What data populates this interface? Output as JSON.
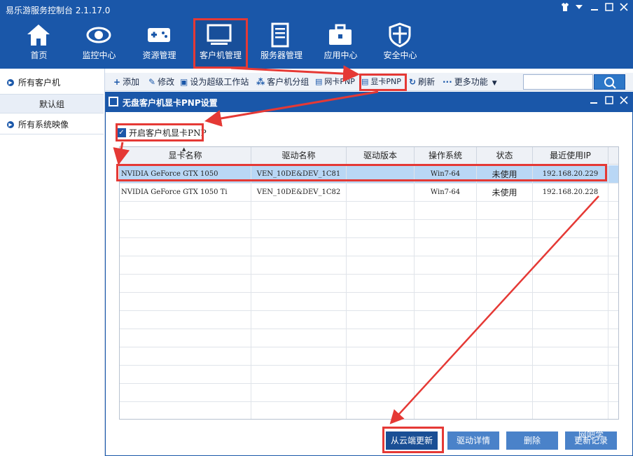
{
  "app": {
    "title": "易乐游服务控制台 2.1.17.0"
  },
  "window_controls": [
    "shirt-icon",
    "dropdown-icon",
    "minimize-icon",
    "maximize-icon",
    "close-icon"
  ],
  "nav": [
    {
      "label": "首页",
      "icon": "home-icon"
    },
    {
      "label": "监控中心",
      "icon": "eye-icon"
    },
    {
      "label": "资源管理",
      "icon": "gamepad-icon"
    },
    {
      "label": "客户机管理",
      "icon": "monitor-icon",
      "active": true
    },
    {
      "label": "服务器管理",
      "icon": "server-icon"
    },
    {
      "label": "应用中心",
      "icon": "toolbox-icon"
    },
    {
      "label": "安全中心",
      "icon": "shield-icon"
    }
  ],
  "sidebar": {
    "items": [
      {
        "label": "所有客户机"
      },
      {
        "label": "默认组"
      },
      {
        "label": "所有系统映像"
      }
    ]
  },
  "toolbar": {
    "add": "添加",
    "edit": "修改",
    "super": "设为超级工作站",
    "group": "客户机分组",
    "nic": "网卡PNP",
    "gpu": "显卡PNP",
    "refresh": "刷新",
    "more": "更多功能"
  },
  "dialog": {
    "title": "无盘客户机显卡PNP设置",
    "enable_label": "开启客户机显卡PNP",
    "columns": [
      "显卡名称",
      "驱动名称",
      "驱动版本",
      "操作系统",
      "状态",
      "最近使用IP"
    ],
    "rows": [
      {
        "name": "NVIDIA GeForce GTX 1050",
        "driver": "VEN_10DE&DEV_1C81",
        "version": "",
        "os": "Win7-64",
        "status": "未使用",
        "ip": "192.168.20.229"
      },
      {
        "name": "NVIDIA GeForce GTX 1050 Ti",
        "driver": "VEN_10DE&DEV_1C82",
        "version": "",
        "os": "Win7-64",
        "status": "未使用",
        "ip": "192.168.20.228"
      }
    ],
    "buttons": {
      "cloud_update": "从云端更新",
      "driver_detail": "驱动详情",
      "delete": "删除",
      "update_record": "更新记录"
    }
  },
  "colors": {
    "primary": "#1a57a9",
    "highlight": "#e53935",
    "selected_row": "#b9d7f5"
  },
  "watermark": "网吧学"
}
